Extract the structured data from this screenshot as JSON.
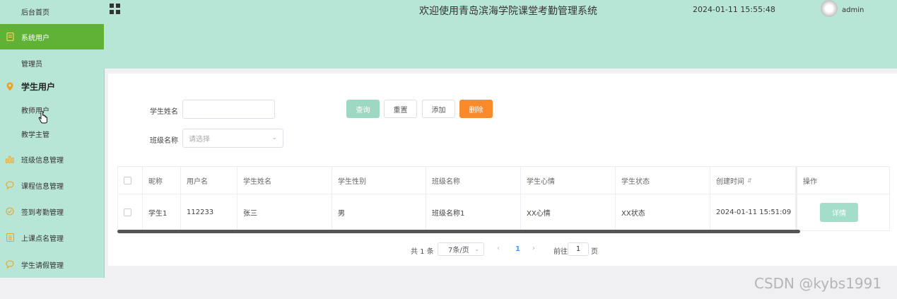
{
  "sidebar": {
    "items": [
      {
        "label": "后台首页",
        "icon": "",
        "type": "link"
      },
      {
        "label": "系统用户",
        "icon": "document-icon",
        "type": "active"
      },
      {
        "label": "管理员",
        "icon": "",
        "type": "sub"
      },
      {
        "label": "学生用户",
        "icon": "location-pin-icon",
        "type": "group"
      },
      {
        "label": "教师用户",
        "icon": "",
        "type": "sub"
      },
      {
        "label": "教学主管",
        "icon": "",
        "type": "sub"
      },
      {
        "label": "班级信息管理",
        "icon": "bar-chart-icon",
        "type": "link"
      },
      {
        "label": "课程信息管理",
        "icon": "chat-bubble-icon",
        "type": "link"
      },
      {
        "label": "签到考勤管理",
        "icon": "check-circle-icon",
        "type": "link"
      },
      {
        "label": "上课点名管理",
        "icon": "list-icon",
        "type": "link"
      },
      {
        "label": "学生请假管理",
        "icon": "chat-bubble-icon",
        "type": "link"
      }
    ]
  },
  "header": {
    "title": "欢迎使用青岛滨海学院课堂考勤管理系统",
    "datetime": "2024-01-11 15:55:48",
    "username": "admin"
  },
  "search": {
    "name_label": "学生姓名",
    "name_value": "",
    "class_label": "班级名称",
    "class_placeholder": "请选择",
    "buttons": {
      "query": "查询",
      "reset": "重置",
      "add": "添加",
      "delete": "删除"
    }
  },
  "table": {
    "headers": [
      "昵称",
      "用户名",
      "学生姓名",
      "学生性别",
      "班级名称",
      "学生心情",
      "学生状态",
      "创建时间",
      "操作"
    ],
    "rows": [
      {
        "nickname": "学生1",
        "username": "112233",
        "name": "张三",
        "gender": "男",
        "class_name": "班级名称1",
        "mood": "XX心情",
        "status": "XX状态",
        "created": "2024-01-11 15:51:09",
        "action": "详情"
      }
    ]
  },
  "pagination": {
    "total": "共 1 条",
    "page_size": "7条/页",
    "prev": "‹",
    "current": "1",
    "next": "›",
    "goto_label": "前往",
    "goto_value": "1",
    "page_suffix": "页"
  },
  "watermark": "CSDN @kybs1991",
  "colors": {
    "sidebar_bg": "#b8e6d6",
    "active_item": "#5fb236",
    "query_button": "#9fd8c2",
    "delete_button": "#fb8b2a",
    "icon_accent": "#e8a22a"
  }
}
